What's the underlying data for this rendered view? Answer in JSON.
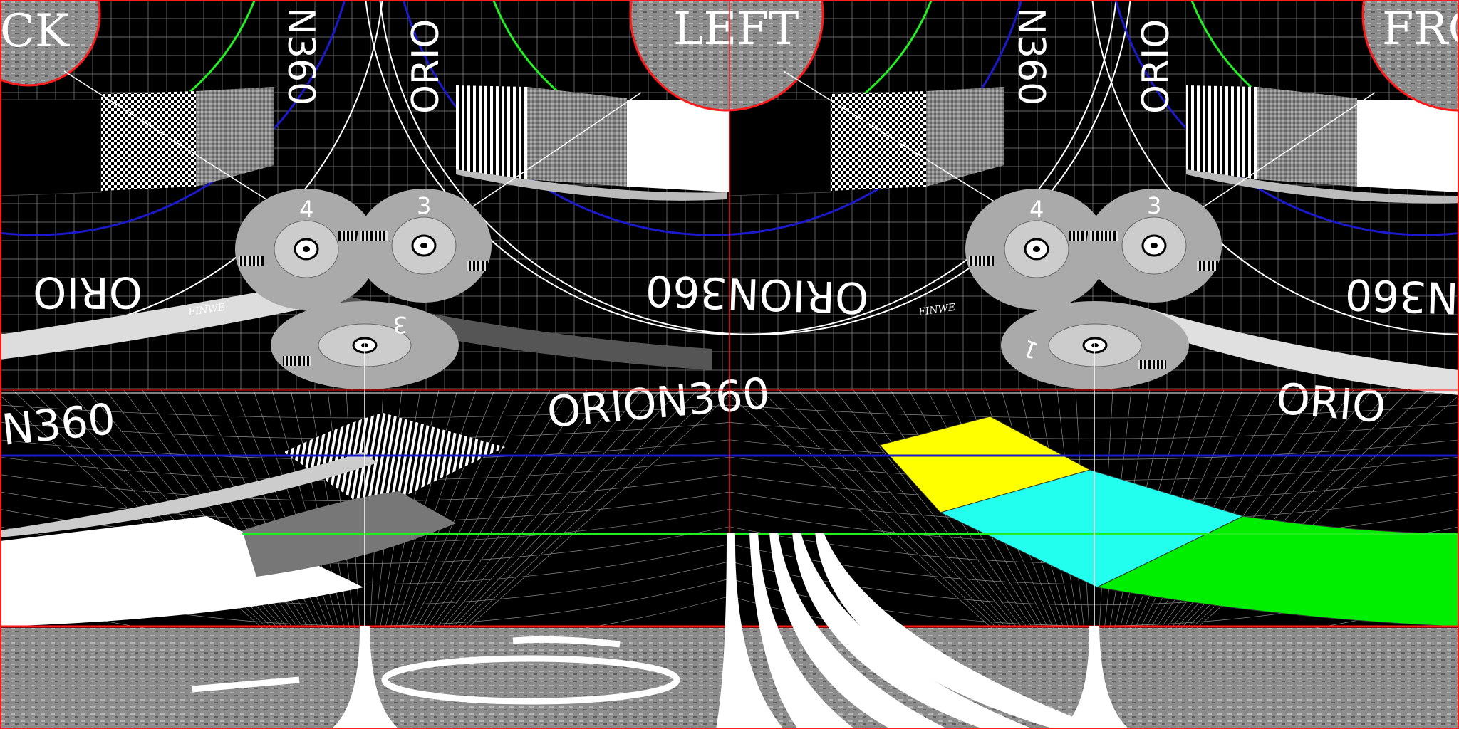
{
  "faces": {
    "back": "CK",
    "left": "LEFT",
    "front": "FRO"
  },
  "brand": {
    "wordmark_1": "ORION360",
    "wordmark_2": "ORION360",
    "wordmark_3": "ORIO",
    "wordmark_4": "N360",
    "wordmark_5": "ORIO",
    "wordmark_6": "N360",
    "wordmark_7": "ORIO",
    "wordmark_8": "N360",
    "wordmark_9": "ORIO",
    "signature": "FINWE"
  },
  "targets": {
    "target_a": "4",
    "target_b": "3",
    "target_c": "3",
    "target_d": "4",
    "target_e": "3",
    "target_f": "1"
  },
  "colors": {
    "grid": "#8a8a8a",
    "red": "#ff1a1a",
    "green": "#22ee22",
    "blue": "#1a1acc",
    "yellow": "#ffff00",
    "cyan": "#22ffee",
    "lime": "#00ee00",
    "gray_disc": "#aaaaaa",
    "texture": "#8c8c8c"
  }
}
